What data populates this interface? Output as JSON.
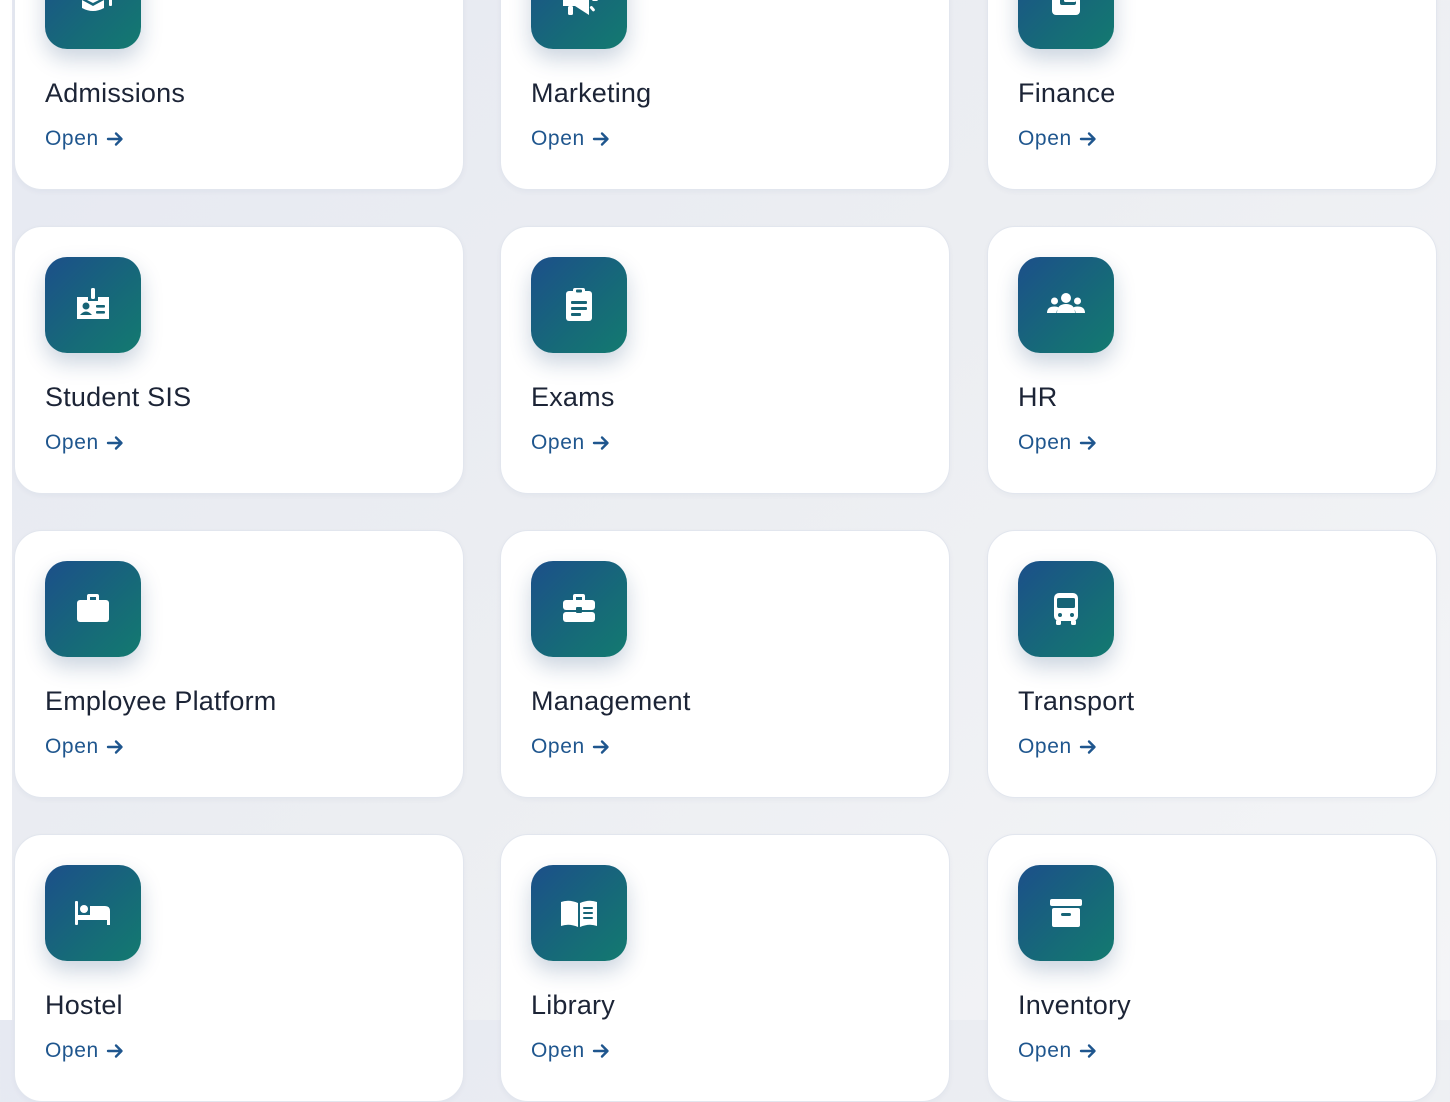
{
  "modules": [
    {
      "title": "Admissions",
      "link_label": "Open",
      "icon": "graduation-cap-icon"
    },
    {
      "title": "Marketing",
      "link_label": "Open",
      "icon": "megaphone-icon"
    },
    {
      "title": "Finance",
      "link_label": "Open",
      "icon": "wallet-icon"
    },
    {
      "title": "Student SIS",
      "link_label": "Open",
      "icon": "id-badge-icon"
    },
    {
      "title": "Exams",
      "link_label": "Open",
      "icon": "clipboard-icon"
    },
    {
      "title": "HR",
      "link_label": "Open",
      "icon": "users-icon"
    },
    {
      "title": "Employee Platform",
      "link_label": "Open",
      "icon": "briefcase-icon"
    },
    {
      "title": "Management",
      "link_label": "Open",
      "icon": "toolbox-icon"
    },
    {
      "title": "Transport",
      "link_label": "Open",
      "icon": "bus-icon"
    },
    {
      "title": "Hostel",
      "link_label": "Open",
      "icon": "bed-icon"
    },
    {
      "title": "Library",
      "link_label": "Open",
      "icon": "book-open-icon"
    },
    {
      "title": "Inventory",
      "link_label": "Open",
      "icon": "archive-box-icon"
    }
  ],
  "colors": {
    "icon_gradient_start": "#1c4f8a",
    "icon_gradient_end": "#137a70",
    "link": "#1f568e",
    "title": "#1c2436"
  }
}
